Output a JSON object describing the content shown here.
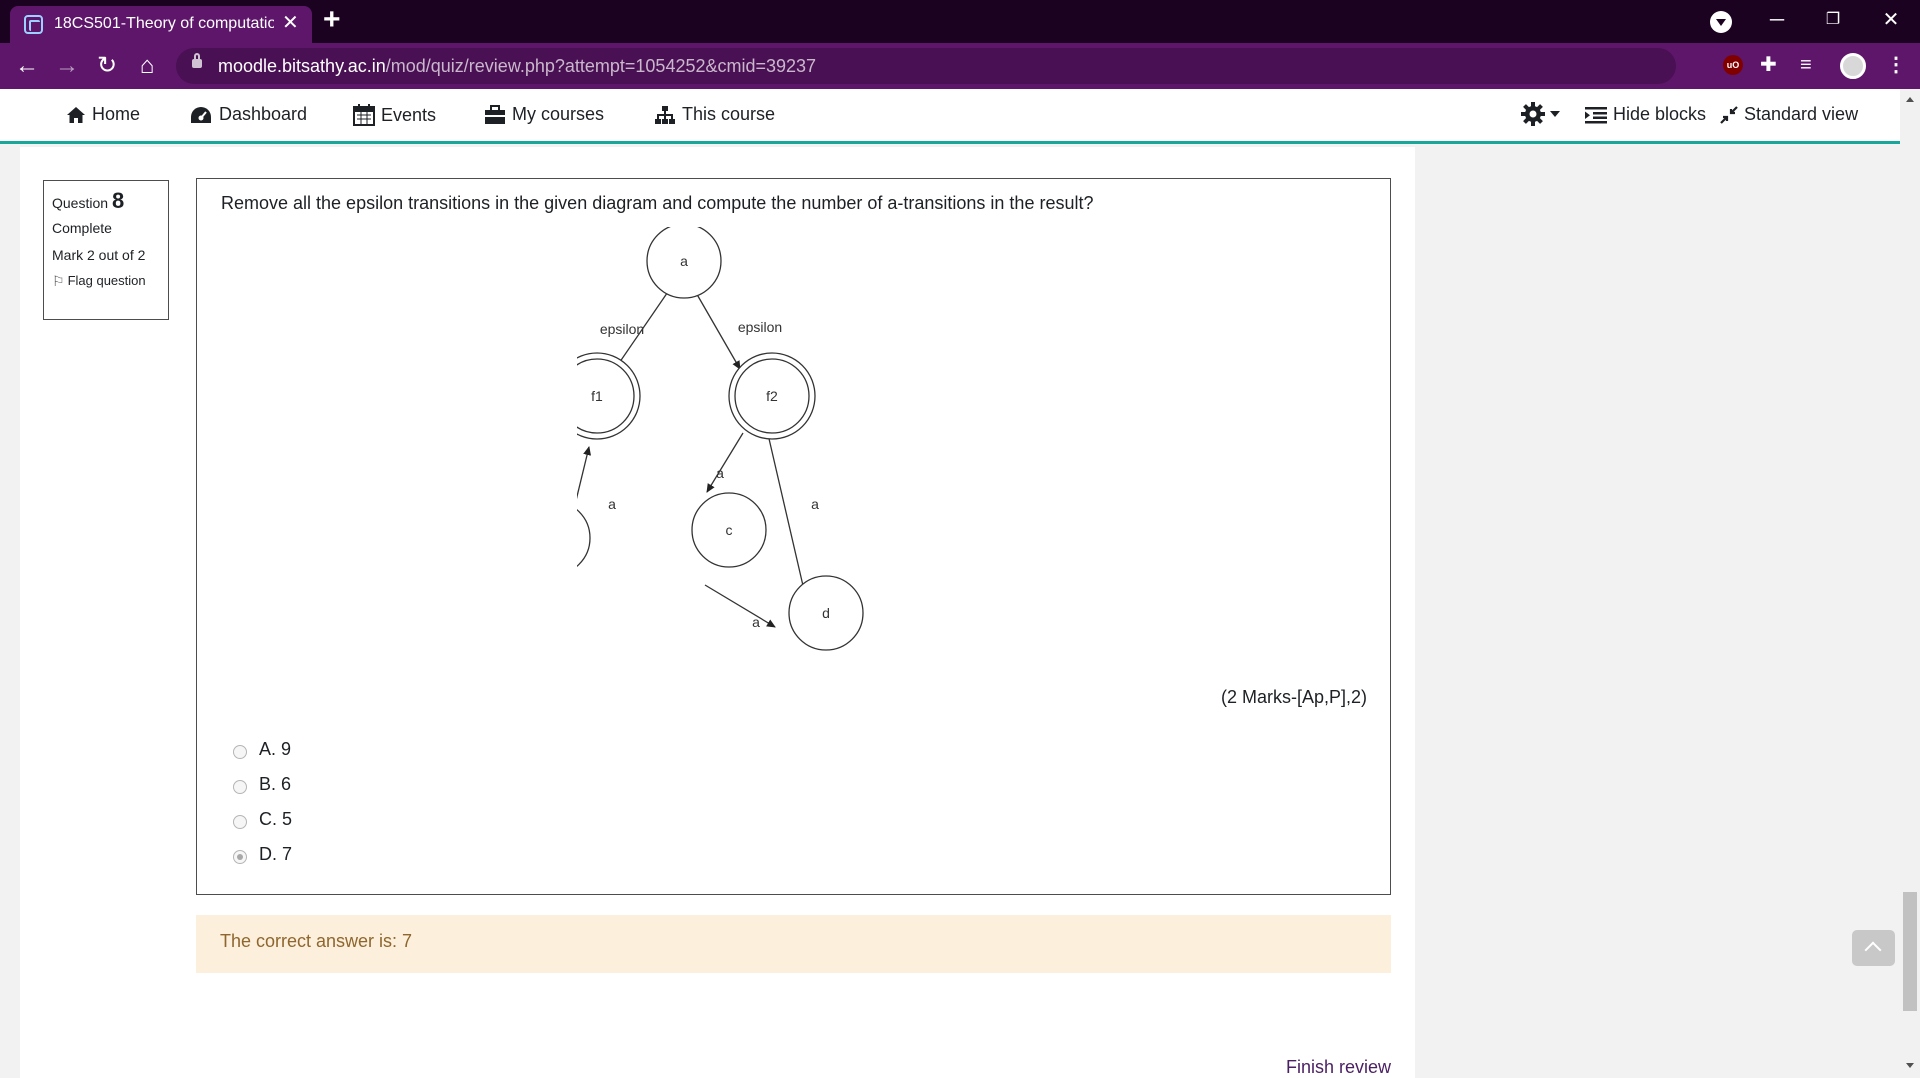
{
  "browser": {
    "tab_title": "18CS501-Theory of computation",
    "tab_close": "✕",
    "new_tab": "+",
    "url_host": "moodle.bitsathy.ac.in",
    "url_path": "/mod/quiz/review.php?attempt=1054252&cmid=39237",
    "ublock_label": "uO"
  },
  "navbar": {
    "home": "Home",
    "dashboard": "Dashboard",
    "events": "Events",
    "my_courses": "My courses",
    "this_course": "This course",
    "hide_blocks": "Hide blocks",
    "standard_view": "Standard view"
  },
  "question_info": {
    "label": "Question",
    "number": "8",
    "state": "Complete",
    "grade": "Mark 2 out of 2",
    "flag": "Flag question"
  },
  "question": {
    "text": "Remove all the epsilon transitions in the given diagram and compute the number of a-transitions in the result?",
    "marks": "(2 Marks-[Ap,P],2)",
    "options": [
      {
        "label": "A. 9",
        "selected": false
      },
      {
        "label": "B. 6",
        "selected": false
      },
      {
        "label": "C. 5",
        "selected": false
      },
      {
        "label": "D. 7",
        "selected": true
      }
    ]
  },
  "diagram": {
    "states": [
      "a",
      "f1",
      "f2",
      "b",
      "c",
      "d"
    ],
    "accepting_states": [
      "f1",
      "f2"
    ],
    "edge_labels": {
      "a_f1": "epsilon",
      "a_f2": "epsilon",
      "f1_b": "a",
      "b_f1": "a",
      "f2_c": "a",
      "d_f2": "a",
      "c_d": "a"
    }
  },
  "feedback": {
    "text": "The correct answer is: 7"
  },
  "footer": {
    "finish_review": "Finish review"
  }
}
